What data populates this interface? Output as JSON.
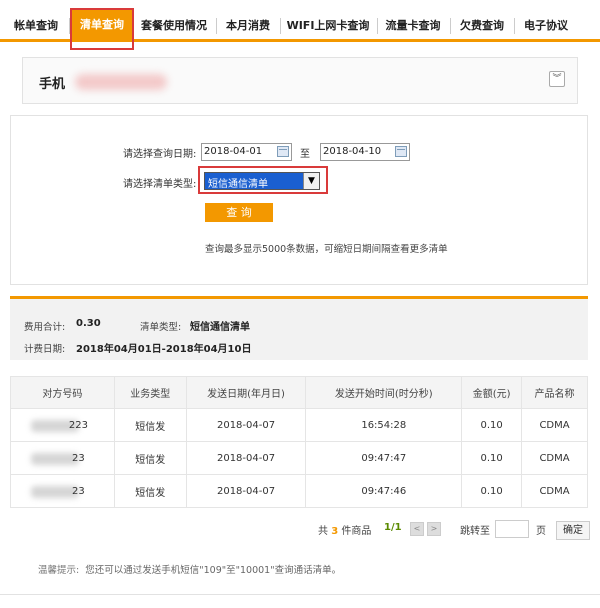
{
  "tabs": [
    {
      "label": "帐单查询"
    },
    {
      "label": "清单查询"
    },
    {
      "label": "套餐使用情况"
    },
    {
      "label": "本月消费"
    },
    {
      "label": "WIFI上网卡查询"
    },
    {
      "label": "流量卡查询"
    },
    {
      "label": "欠费查询"
    },
    {
      "label": "电子协议"
    }
  ],
  "phone": {
    "label": "手机"
  },
  "form": {
    "date_label": "请选择查询日期:",
    "start_date": "2018-04-01",
    "to_label": "至",
    "end_date": "2018-04-10",
    "type_label": "请选择清单类型:",
    "type_value": "短信通信清单",
    "query_button": "查 询",
    "hint": "查询最多显示5000条数据，可缩短日期间隔查看更多清单"
  },
  "summary": {
    "fee_label": "费用合计:",
    "fee_value": "0.30",
    "type_label": "清单类型:",
    "type_value": "短信通信清单",
    "period_label": "计费日期:",
    "period_value": "2018年04月01日-2018年04月10日"
  },
  "table": {
    "headers": [
      "对方号码",
      "业务类型",
      "发送日期(年月日)",
      "发送开始时间(时分秒)",
      "金额(元)",
      "产品名称"
    ],
    "rows": [
      {
        "number_tail": "223",
        "type": "短信发",
        "date": "2018-04-07",
        "time": "16:54:28",
        "amount": "0.10",
        "product": "CDMA"
      },
      {
        "number_tail": "23",
        "type": "短信发",
        "date": "2018-04-07",
        "time": "09:47:47",
        "amount": "0.10",
        "product": "CDMA"
      },
      {
        "number_tail": "23",
        "type": "短信发",
        "date": "2018-04-07",
        "time": "09:47:46",
        "amount": "0.10",
        "product": "CDMA"
      }
    ]
  },
  "pager": {
    "total_prefix": "共",
    "total_count": "3",
    "total_suffix": "件商品",
    "page_info": "1/1",
    "prev": "<",
    "next": ">",
    "goto_label": "跳转至",
    "page_unit": "页",
    "confirm": "确定"
  },
  "tip": {
    "label": "温馨提示:",
    "text": "您还可以通过发送手机短信\"109\"至\"10001\"查询通话清单。"
  },
  "colors": {
    "accent": "#f39800",
    "highlight_border": "#d93a3a",
    "select_bg": "#1a5fd0"
  },
  "icons": {
    "calendar": "calendar-icon",
    "expand": "chevron-down-icon",
    "dropdown": "dropdown-arrow-icon"
  }
}
